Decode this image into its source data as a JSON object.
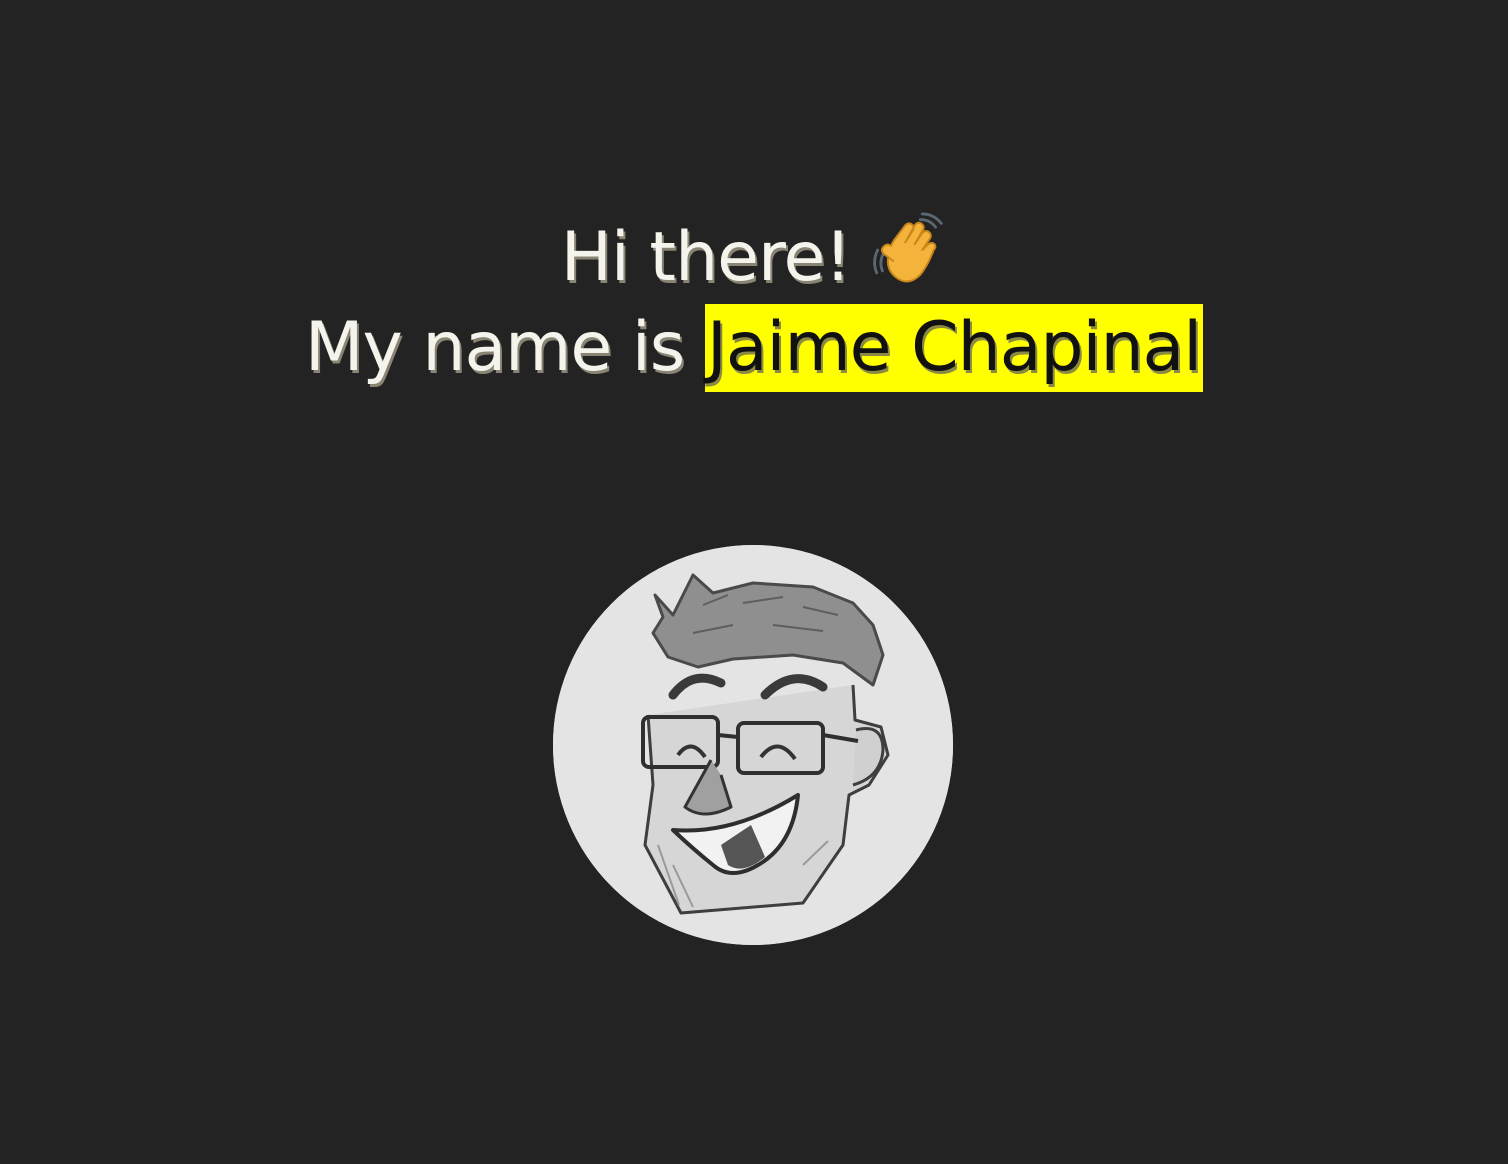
{
  "intro": {
    "greeting": "Hi there!",
    "greeting_icon": "waving-hand-icon",
    "name_prefix": "My name is",
    "name": "Jaime Chapinal",
    "highlight_color": "#ffff00",
    "text_color": "#f4f4ec"
  },
  "avatar": {
    "icon": "caricature-sketch-avatar",
    "background_color": "#e4e4e4"
  },
  "page": {
    "background_color": "#232323"
  }
}
